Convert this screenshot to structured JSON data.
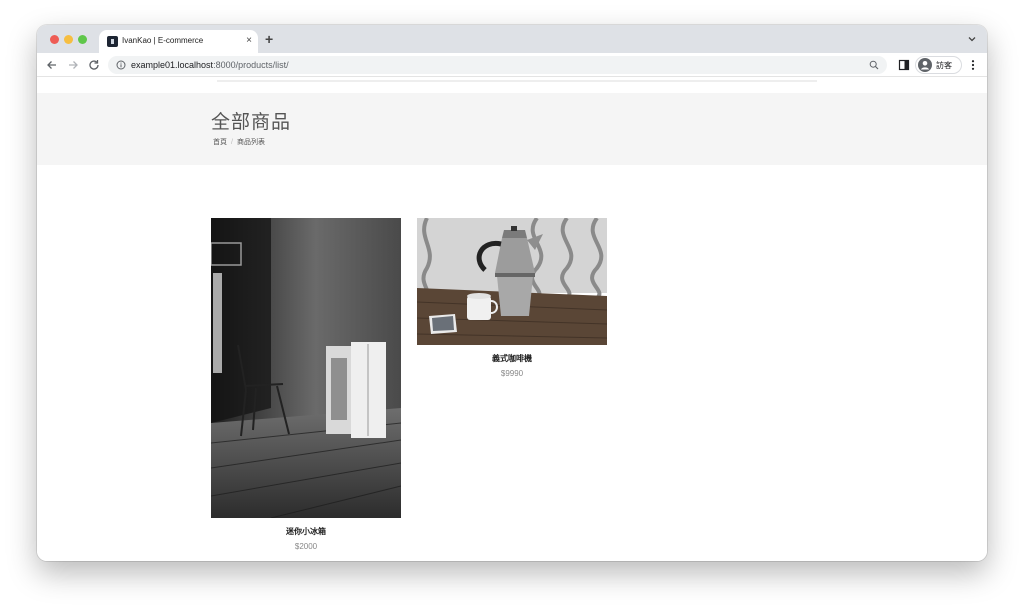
{
  "browser": {
    "tab": {
      "title": "IvanKao | E-commerce",
      "close": "×"
    },
    "new_tab": "+",
    "url": {
      "host": "example01.localhost",
      "path": ":8000/products/list/"
    },
    "profile_label": "訪客"
  },
  "page": {
    "title": "全部商品",
    "breadcrumb": {
      "home": "首頁",
      "current": "商品列表"
    }
  },
  "products": [
    {
      "name": "迷你小冰箱",
      "price": "$2000",
      "image": "fridge-photo"
    },
    {
      "name": "義式咖啡機",
      "price": "$9990",
      "image": "moka-pot-photo"
    }
  ],
  "colors": {
    "tabstrip": "#dee1e6",
    "hero": "#f5f5f5",
    "traffic_red": "#ee5c55",
    "traffic_yellow": "#f6be41",
    "traffic_green": "#5fc74a"
  }
}
